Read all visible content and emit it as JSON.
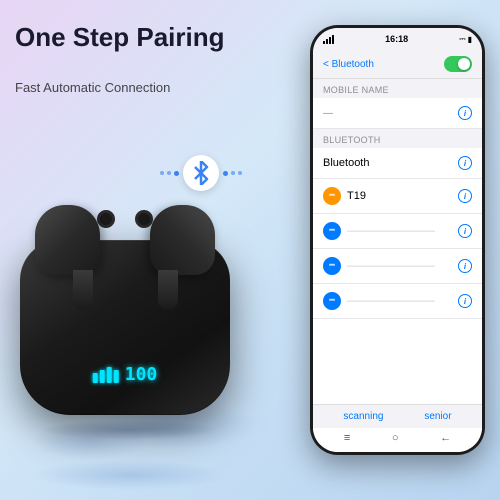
{
  "heading": "One Step Pairing",
  "subheading": "Fast Automatic Connection",
  "battery": {
    "percent": "100"
  },
  "phone": {
    "status_time": "16:18",
    "header_back": "< Bluetooth",
    "header_title": "Bluetooth",
    "section1_label": "Mobile Name",
    "section2_label": "Bluetooth",
    "device_t19": "T19",
    "rows": [
      {
        "id": 1,
        "color": "blue"
      },
      {
        "id": 2,
        "color": "blue"
      },
      {
        "id": 3,
        "color": "blue"
      }
    ],
    "scanning": "scanning",
    "senior": "senior",
    "home_icon1": "≡",
    "home_icon2": "○",
    "home_icon3": "←"
  },
  "icons": {
    "bluetooth": "ᛒ",
    "info": "i",
    "chevron": "❯"
  }
}
